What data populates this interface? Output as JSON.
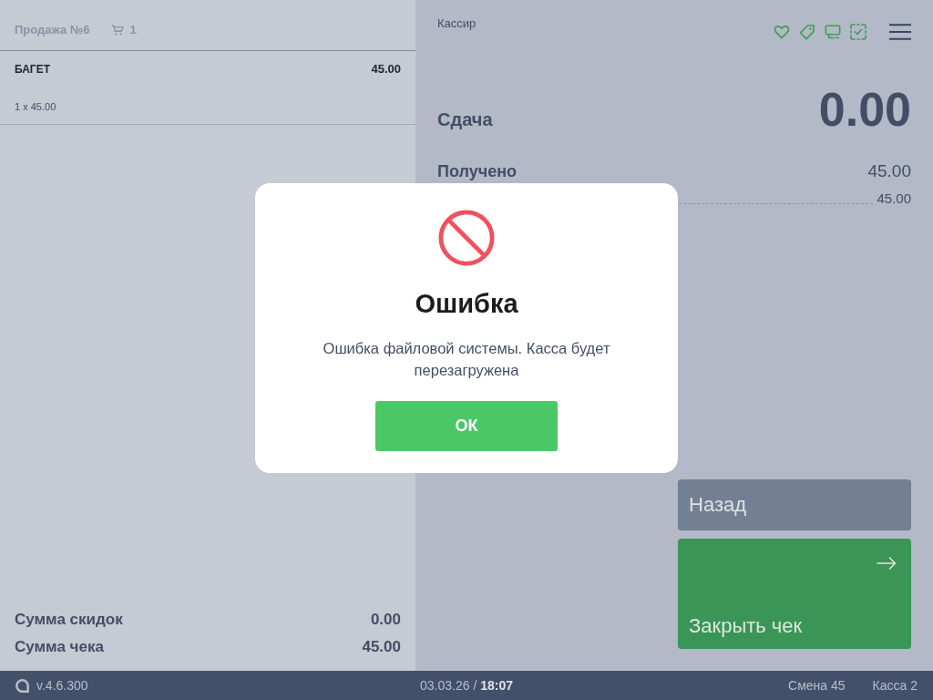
{
  "sale_panel": {
    "title": "Продажа №6",
    "cart_count": "1",
    "items": [
      {
        "name": "БАГЕТ",
        "price": "45.00",
        "quantity_line": "1 x 45.00"
      }
    ],
    "totals": [
      {
        "label": "Сумма скидок",
        "value": "0.00"
      },
      {
        "label": "Сумма чека",
        "value": "45.00"
      }
    ]
  },
  "payment_panel": {
    "user": "Кассир",
    "change": {
      "label": "Сдача",
      "value": "0.00"
    },
    "received": {
      "label": "Получено",
      "value": "45.00"
    },
    "payments": [
      {
        "amount": "45.00"
      }
    ],
    "buttons": [
      {
        "label": "Назад",
        "kind": "back"
      },
      {
        "label": "Закрыть чек",
        "kind": "close"
      }
    ]
  },
  "dialog": {
    "title": "Ошибка",
    "message": "Ошибка файловой системы. Касса будет перезагружена",
    "button": "ОК"
  },
  "status_bar": {
    "version": "v.4.6.300",
    "date_time": "03.03.26 / **18:07**",
    "shift": "Смена 45",
    "register": "Касса 2"
  }
}
